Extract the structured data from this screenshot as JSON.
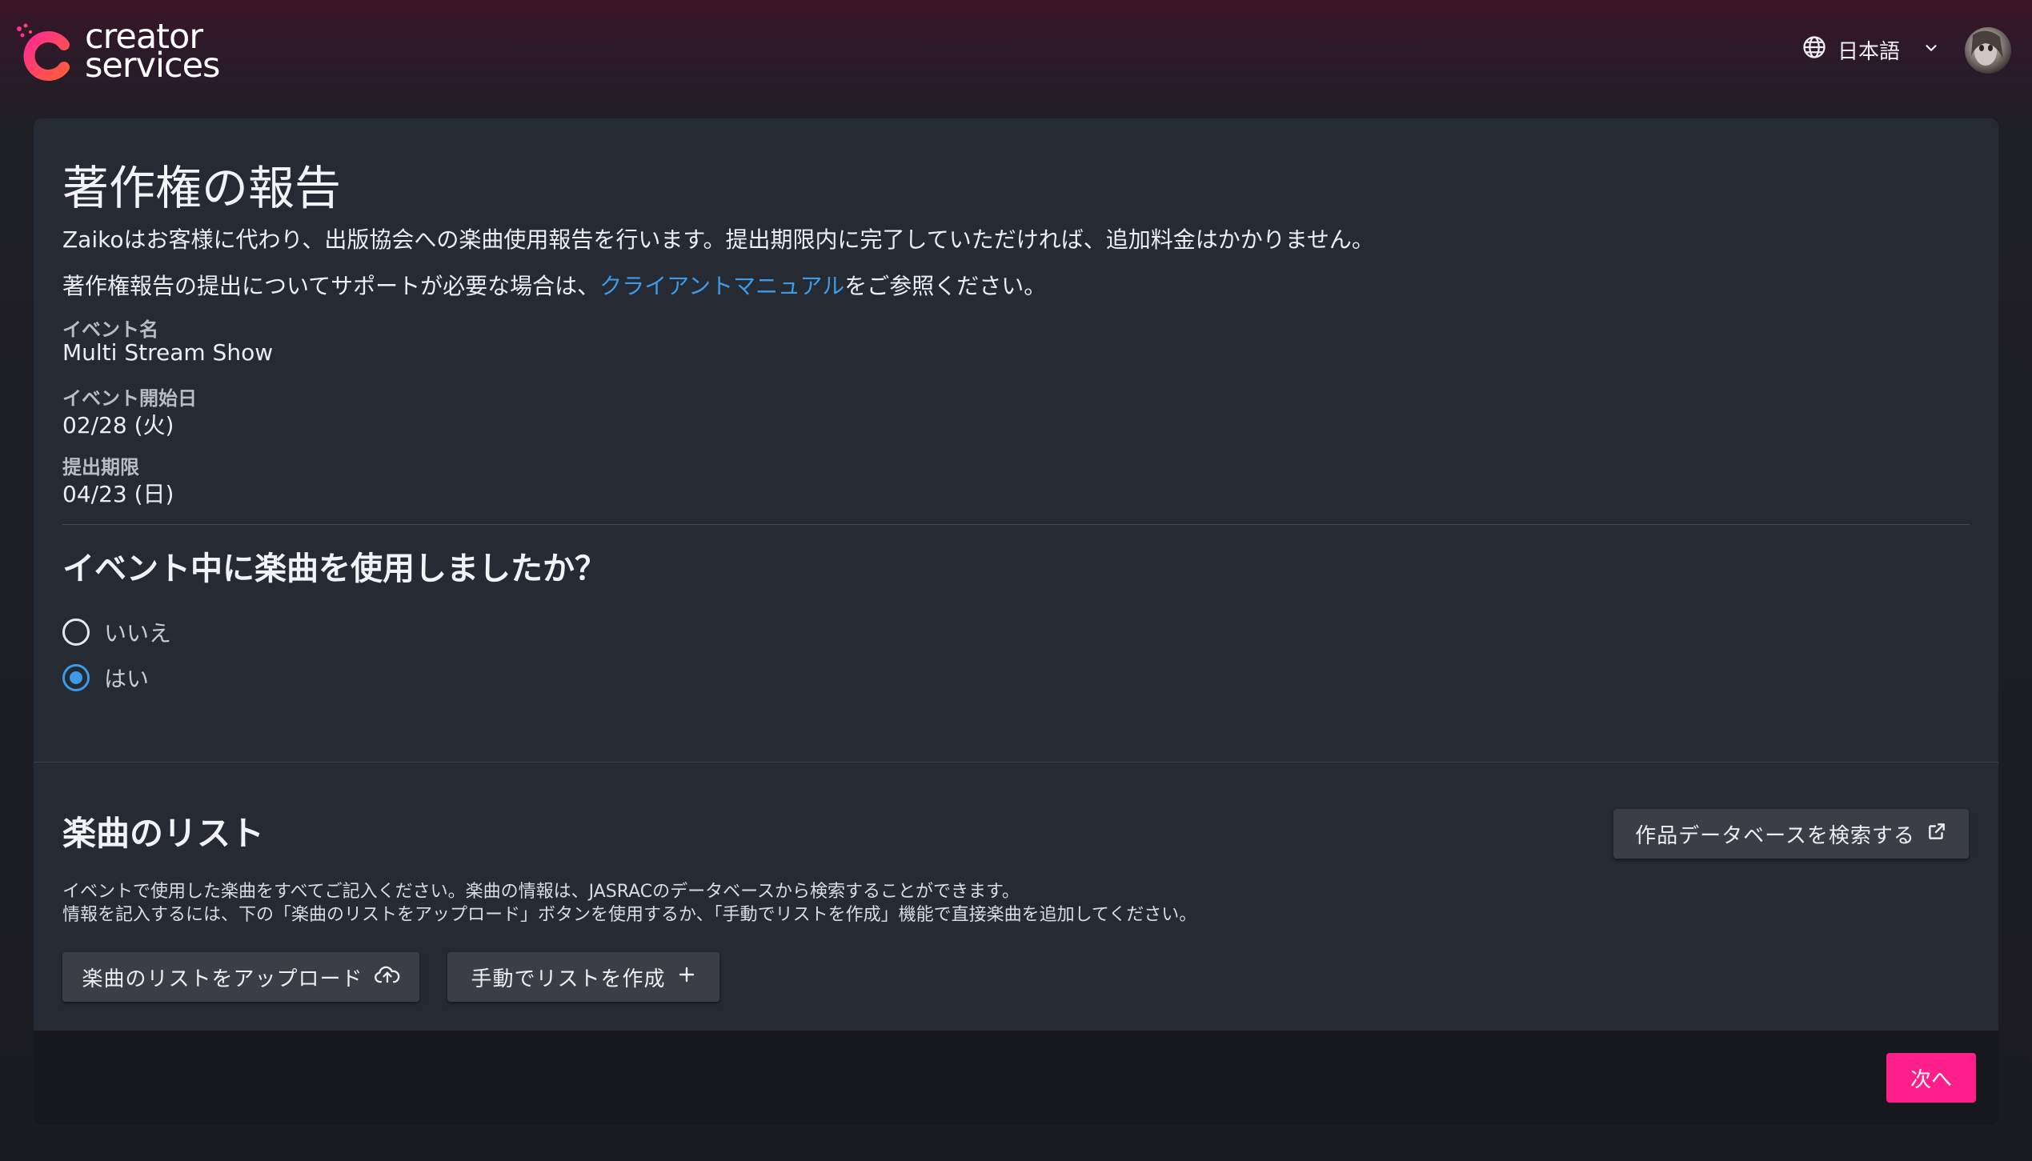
{
  "header": {
    "logo_line1": "creator",
    "logo_line2": "services",
    "language_label": "日本語",
    "brand_color": "#ff1f8a"
  },
  "page": {
    "title": "著作権の報告",
    "intro": "Zaikoはお客様に代わり、出版協会への楽曲使用報告を行います。提出期限内に完了していただければ、追加料金はかかりません。",
    "support_prefix": "著作権報告の提出についてサポートが必要な場合は、",
    "support_link": "クライアントマニュアル",
    "support_suffix": "をご参照ください。"
  },
  "event": {
    "name_label": "イベント名",
    "name_value": "Multi Stream Show",
    "start_label": "イベント開始日",
    "start_value": "02/28 (火)",
    "deadline_label": "提出期限",
    "deadline_value": "04/23 (日)"
  },
  "question": {
    "title": "イベント中に楽曲を使用しましたか？",
    "options": [
      {
        "label": "いいえ",
        "checked": false
      },
      {
        "label": "はい",
        "checked": true
      }
    ]
  },
  "songs": {
    "title": "楽曲のリスト",
    "search_db_button": "作品データベースを検索する",
    "desc_line1": "イベントで使用した楽曲をすべてご記入ください。楽曲の情報は、JASRACのデータベースから検索することができます。",
    "desc_line2": "情報を記入するには、下の「楽曲のリストをアップロード」ボタンを使用するか、「手動でリストを作成」機能で直接楽曲を追加してください。",
    "upload_button": "楽曲のリストをアップロード",
    "manual_button": "手動でリストを作成"
  },
  "footer": {
    "next_button": "次へ"
  },
  "icons": {
    "globe": "globe-icon",
    "chevron": "chevron-down-icon",
    "external": "external-link-icon",
    "cloud_upload": "cloud-upload-icon",
    "plus": "plus-icon"
  }
}
